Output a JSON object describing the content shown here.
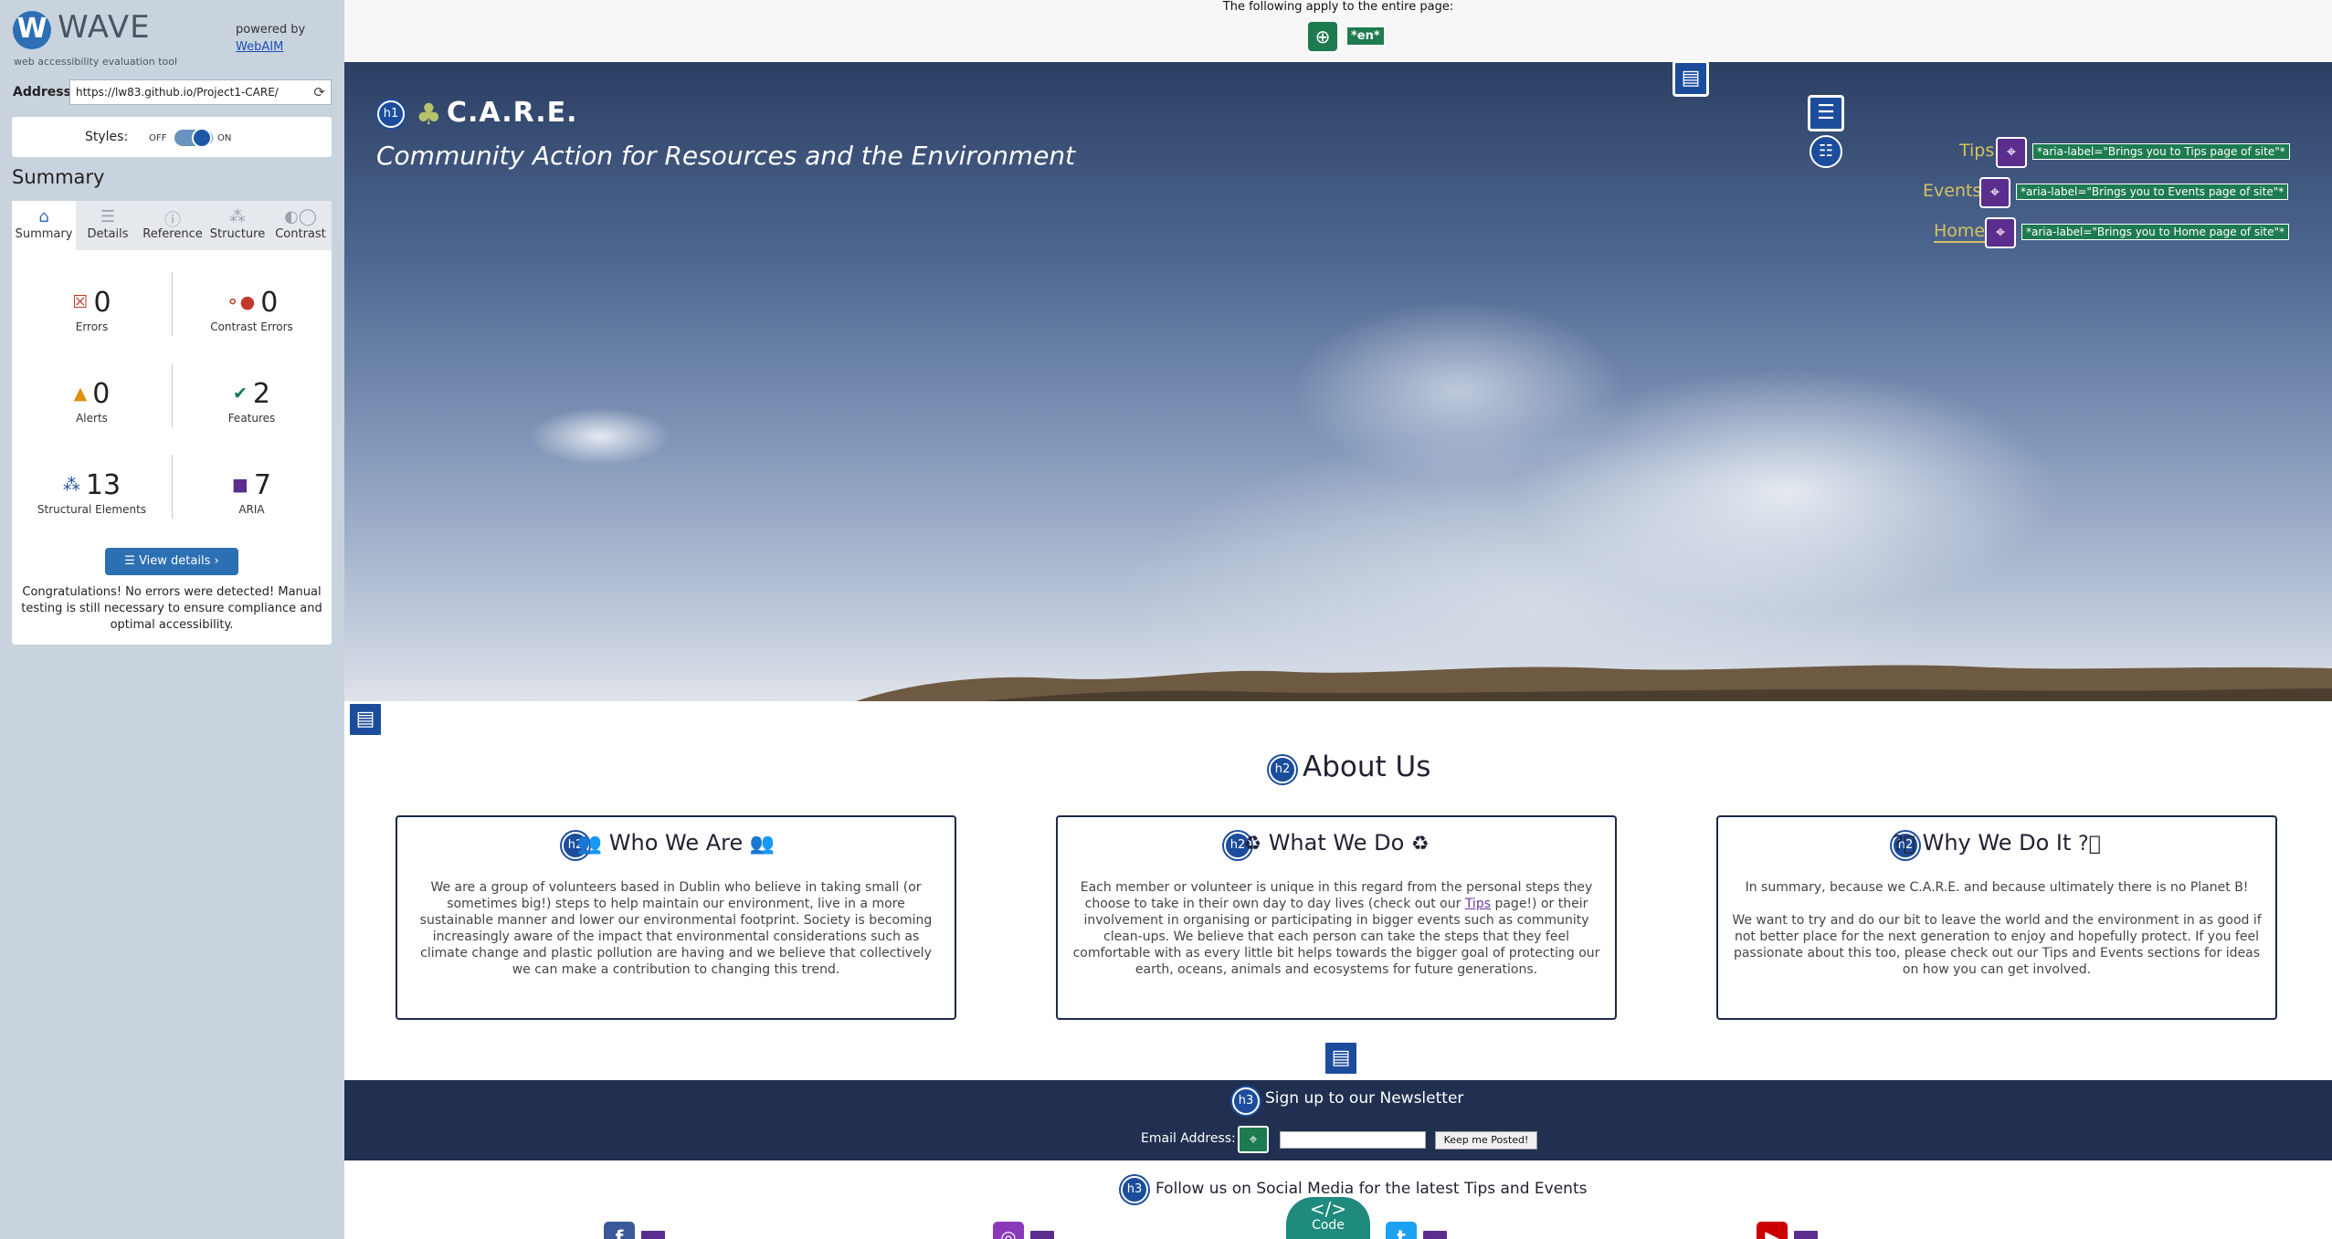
{
  "wave": {
    "brand": "WAVE",
    "tagline": "web accessibility evaluation tool",
    "powered_by": "powered by",
    "powered_link": "WebAIM",
    "address_label": "Address:",
    "address_value": "https://lw83.github.io/Project1-CARE/",
    "styles_label": "Styles:",
    "styles_off": "OFF",
    "styles_on": "ON",
    "summary_title": "Summary",
    "tabs": [
      {
        "label": "Summary",
        "icon": "home-icon",
        "active": true
      },
      {
        "label": "Details",
        "icon": "list-icon",
        "active": false
      },
      {
        "label": "Reference",
        "icon": "info-icon",
        "active": false
      },
      {
        "label": "Structure",
        "icon": "structure-icon",
        "active": false
      },
      {
        "label": "Contrast",
        "icon": "contrast-icon",
        "active": false
      }
    ],
    "stats": [
      {
        "value": "0",
        "label": "Errors",
        "icon": "error-icon",
        "color": "#c0392b"
      },
      {
        "value": "0",
        "label": "Contrast Errors",
        "icon": "contrast-error-icon",
        "color": "#c0392b"
      },
      {
        "value": "0",
        "label": "Alerts",
        "icon": "alert-icon",
        "color": "#e08e0b"
      },
      {
        "value": "2",
        "label": "Features",
        "icon": "feature-icon",
        "color": "#1e7a4f"
      },
      {
        "value": "13",
        "label": "Structural Elements",
        "icon": "structure-icon",
        "color": "#1c4d9c"
      },
      {
        "value": "7",
        "label": "ARIA",
        "icon": "aria-icon",
        "color": "#5b2e8d"
      }
    ],
    "view_details": "View details ›",
    "congrats": "Congratulations! No errors were detected! Manual testing is still necessary to ensure compliance and optimal accessibility."
  },
  "page": {
    "apply_text": "The following apply to the entire page:",
    "lang_tag": "*en*",
    "h1_badge": "h1",
    "site_title": "C.A.R.E.",
    "site_subtitle": "Community Action for Resources and the Environment",
    "nav": [
      {
        "label": "Tips",
        "aria": "*aria-label=\"Brings you to Tips page of site\"*"
      },
      {
        "label": "Events",
        "aria": "*aria-label=\"Brings you to Events page of site\"*"
      },
      {
        "label": "Home",
        "aria": "*aria-label=\"Brings you to Home page of site\"*"
      }
    ],
    "about_badge": "h2",
    "about_title": "About Us",
    "cards": [
      {
        "badge": "h2",
        "title": "Who We Are",
        "icon": "people-icon",
        "body": "We are a group of volunteers based in Dublin who believe in taking small (or sometimes big!) steps to help maintain our environment, live in a more sustainable manner and lower our environmental footprint. Society is becoming increasingly aware of the impact that environmental considerations such as climate change and plastic pollution are having and we believe that collectively we can make a contribution to changing this trend."
      },
      {
        "badge": "h2",
        "title": "What We Do",
        "icon": "recycle-icon",
        "body_before": "Each member or volunteer is unique in this regard from the personal steps they choose to take in their own day to day lives (check out our ",
        "body_link": "Tips",
        "body_after": " page!) or their involvement in organising or participating in bigger events such as community clean-ups. We believe that each person can take the steps that they feel comfortable with as every little bit helps towards the bigger goal of protecting our earth, oceans, animals and ecosystems for future generations."
      },
      {
        "badge": "h2",
        "title": "Why We Do It",
        "icon": "question-icon",
        "body_p1": "In summary, because we C.A.R.E. and because ultimately there is no Planet B!",
        "body_p2": "We want to try and do our bit to leave the world and the environment in as good if not better place for the next generation to enjoy and hopefully protect. If you feel passionate about this too, please check out our Tips and Events sections for ideas on how you can get involved."
      }
    ],
    "newsletter_badge": "h3",
    "newsletter_title": "Sign up to our Newsletter",
    "email_label": "Email Address:",
    "submit_label": "Keep me Posted!",
    "social_badge": "h3",
    "social_title": "Follow us on Social Media for the latest Tips and Events",
    "social": [
      {
        "icon": "facebook-icon",
        "glyph": "f",
        "color": "#3b5998"
      },
      {
        "icon": "instagram-icon",
        "glyph": "◎",
        "color": "#8a3ab9"
      },
      {
        "icon": "twitter-icon",
        "glyph": "t",
        "color": "#1da1f2"
      },
      {
        "icon": "youtube-icon",
        "glyph": "▶",
        "color": "#cc0000"
      }
    ],
    "code_label": "Code",
    "code_glyph": "</>"
  }
}
